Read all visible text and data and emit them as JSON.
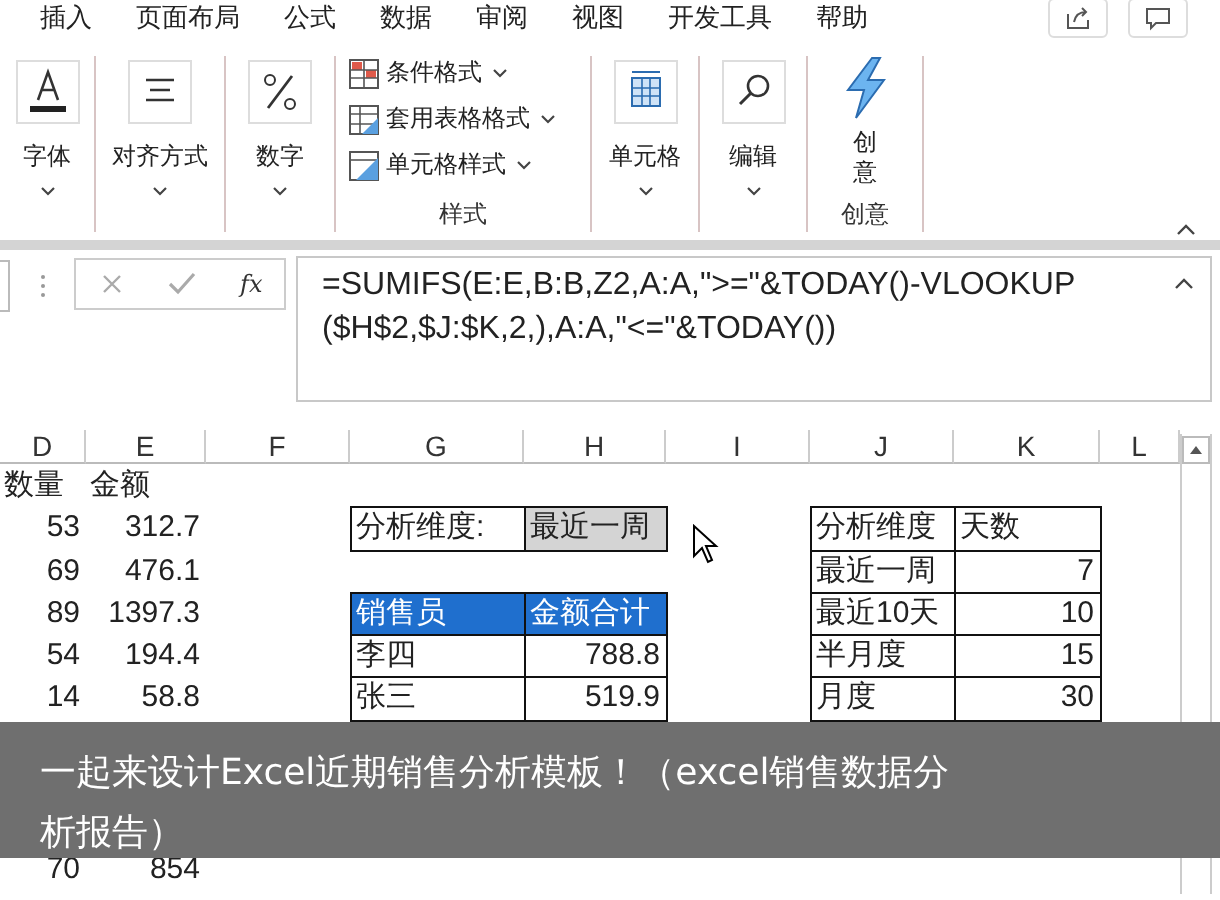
{
  "ribbon": {
    "tabs": [
      {
        "label": "插入",
        "selected": false
      },
      {
        "label": "页面布局",
        "selected": false
      },
      {
        "label": "公式",
        "selected": false
      },
      {
        "label": "数据",
        "selected": false
      },
      {
        "label": "审阅",
        "selected": false
      },
      {
        "label": "视图",
        "selected": false
      },
      {
        "label": "开发工具",
        "selected": false
      },
      {
        "label": "帮助",
        "selected": false
      }
    ],
    "groups": [
      {
        "kind": "button",
        "label": "字体"
      },
      {
        "kind": "button",
        "label": "对齐方式"
      },
      {
        "kind": "button",
        "label": "数字"
      },
      {
        "kind": "list",
        "items": [
          "条件格式",
          "套用表格格式",
          "单元格样式"
        ],
        "group_label": "样式"
      },
      {
        "kind": "button",
        "label": "单元格"
      },
      {
        "kind": "button",
        "label": "编辑"
      },
      {
        "kind": "feature",
        "label": "创意",
        "group_label": "创意"
      }
    ]
  },
  "formula_bar": {
    "fx": "fx",
    "formula": "=SUMIFS(E:E,B:B,Z2,A:A,\">=\"&TODAY()-VLOOKUP($H$2,$J:$K,2,),A:A,\"<=\"&TODAY())"
  },
  "sheet": {
    "columns": [
      "D",
      "E",
      "F",
      "G",
      "H",
      "I",
      "J",
      "K",
      "L"
    ],
    "sales_data": {
      "headers": [
        "数量",
        "金额"
      ],
      "rows": [
        {
          "quantity": "53",
          "amount": "312.7"
        },
        {
          "quantity": "69",
          "amount": "476.1"
        },
        {
          "quantity": "89",
          "amount": "1397.3"
        },
        {
          "quantity": "54",
          "amount": "194.4"
        },
        {
          "quantity": "14",
          "amount": "58.8"
        }
      ],
      "row_below_caption": {
        "quantity": "70",
        "amount": "854"
      }
    },
    "selector": {
      "label": "分析维度:",
      "value": "最近一周"
    },
    "summary_table": {
      "columns": [
        "销售员",
        "金额合计"
      ],
      "rows": [
        [
          "李四",
          "788.8"
        ],
        [
          "张三",
          "519.9"
        ]
      ]
    },
    "lookup_table": {
      "columns": [
        "分析维度",
        "天数"
      ],
      "rows": [
        [
          "最近一周",
          "7"
        ],
        [
          "最近10天",
          "10"
        ],
        [
          "半月度",
          "15"
        ],
        [
          "月度",
          "30"
        ]
      ]
    }
  },
  "caption": "一起来设计Excel近期销售分析模板！（excel销售数据分析报告）"
}
